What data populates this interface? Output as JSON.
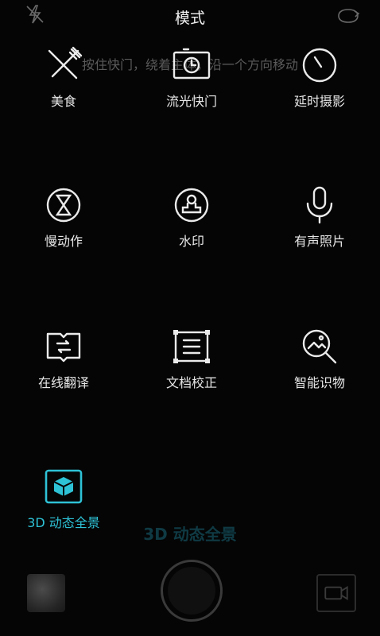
{
  "header": {
    "title": "模式",
    "flash_icon": "flash-off-icon",
    "switch_icon": "switch-camera-icon"
  },
  "hint": "按住快门，绕着主体，沿一个方向移动",
  "modes": [
    {
      "label": "美食",
      "icon": "food-icon"
    },
    {
      "label": "流光快门",
      "icon": "light-painting-icon"
    },
    {
      "label": "延时摄影",
      "icon": "timelapse-icon"
    },
    {
      "label": "慢动作",
      "icon": "slow-motion-icon"
    },
    {
      "label": "水印",
      "icon": "watermark-icon"
    },
    {
      "label": "有声照片",
      "icon": "audio-photo-icon"
    },
    {
      "label": "在线翻译",
      "icon": "translate-icon"
    },
    {
      "label": "文档校正",
      "icon": "document-correct-icon"
    },
    {
      "label": "智能识物",
      "icon": "object-recognition-icon"
    },
    {
      "label": "3D 动态全景",
      "icon": "3d-panorama-icon",
      "active": true
    }
  ],
  "current_mode_watermark": "3D 动态全景",
  "bottom": {
    "gallery_icon": "gallery-thumbnail",
    "shutter_icon": "shutter-button",
    "video_icon": "video-record-icon"
  },
  "colors": {
    "accent": "#2ec2d6",
    "background": "#050505"
  }
}
